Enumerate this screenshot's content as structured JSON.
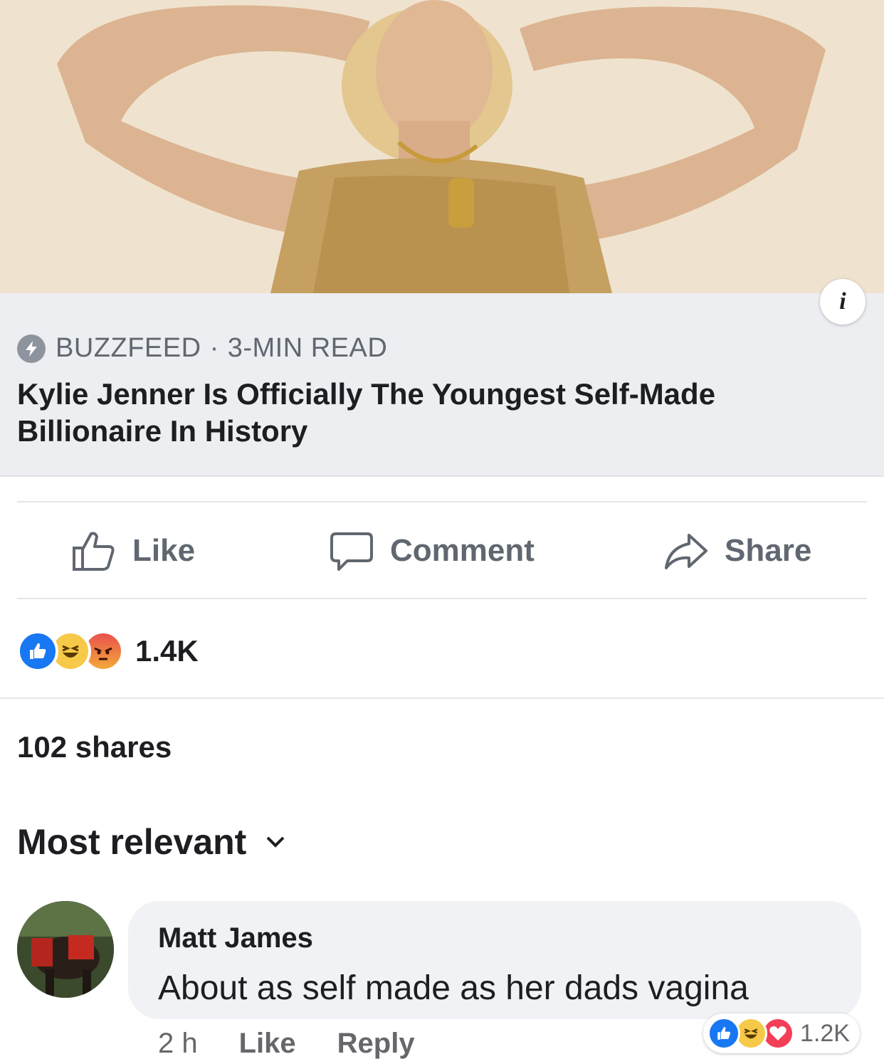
{
  "link_preview": {
    "source": "BUZZFEED",
    "separator": "·",
    "read_time": "3-MIN READ",
    "headline": "Kylie Jenner Is Officially The Youngest Self-Made Billionaire In History",
    "info_label": "i"
  },
  "actions": {
    "like": "Like",
    "comment": "Comment",
    "share": "Share"
  },
  "reactions": {
    "icons": [
      "like-reaction-icon",
      "haha-reaction-icon",
      "angry-reaction-icon"
    ],
    "count": "1.4K"
  },
  "shares": "102 shares",
  "sort": {
    "label": "Most relevant",
    "icon": "chevron-down-icon"
  },
  "comment": {
    "author": "Matt James",
    "text": "About as self made as her dads vagina",
    "time": "2 h",
    "like_label": "Like",
    "reply_label": "Reply",
    "reaction_icons": [
      "like-reaction-icon",
      "haha-reaction-icon",
      "love-reaction-icon"
    ],
    "reaction_count": "1.2K"
  },
  "colors": {
    "facebook_blue": "#1877f2",
    "card_background": "#eceef2",
    "muted_text": "#606770"
  }
}
